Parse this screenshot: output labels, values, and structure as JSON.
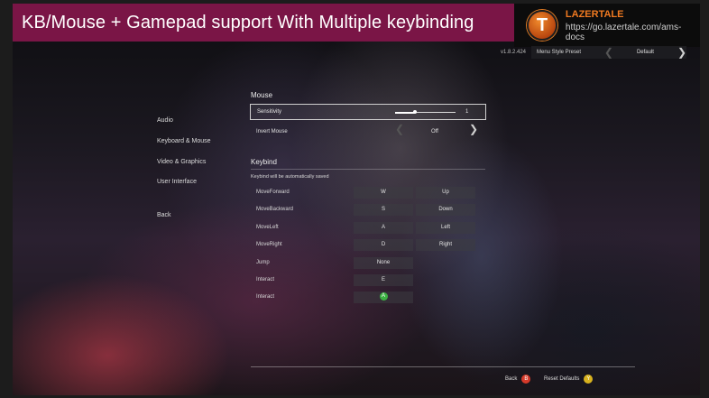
{
  "banner": {
    "title": "KB/Mouse + Gamepad support With Multiple keybinding"
  },
  "brand": {
    "logo_letter": "T",
    "name": "LAZERTALE",
    "url": "https://go.lazertale.com/ams-docs"
  },
  "topbar": {
    "version": "v1.8.2.424",
    "preset_label": "Menu Style Preset",
    "preset_value": "Default"
  },
  "menu": {
    "items": [
      "Audio",
      "Keyboard & Mouse",
      "Video & Graphics",
      "User Interface"
    ],
    "back": "Back"
  },
  "mouse": {
    "title": "Mouse",
    "sensitivity_label": "Sensitivity",
    "sensitivity_value": "1",
    "sensitivity_fraction": 0.33,
    "invert_label": "Invert Mouse",
    "invert_value": "Off"
  },
  "keybind": {
    "title": "Keybind",
    "note": "Keybind will be automatically saved",
    "rows": [
      {
        "action": "MoveForward",
        "primary": "W",
        "alt": "Up"
      },
      {
        "action": "MoveBackward",
        "primary": "S",
        "alt": "Down"
      },
      {
        "action": "MoveLeft",
        "primary": "A",
        "alt": "Left"
      },
      {
        "action": "MoveRight",
        "primary": "D",
        "alt": "Right"
      },
      {
        "action": "Jump",
        "primary": "None",
        "alt": null
      },
      {
        "action": "Interact",
        "primary": "E",
        "alt": null
      },
      {
        "action": "Interact",
        "primary": "A",
        "alt": null,
        "primary_is_gamepad": true
      }
    ]
  },
  "footer": {
    "back_label": "Back",
    "back_button": "B",
    "reset_label": "Reset Defaults",
    "reset_button": "Y"
  },
  "colors": {
    "banner": "#7a1546",
    "brand_orange": "#f07a21",
    "gamepad_a": "#3cb043",
    "gamepad_b": "#d63a2a",
    "gamepad_y": "#d8b21e"
  },
  "icons": {
    "chevron_left": "chevron-left-icon",
    "chevron_right": "chevron-right-icon"
  }
}
